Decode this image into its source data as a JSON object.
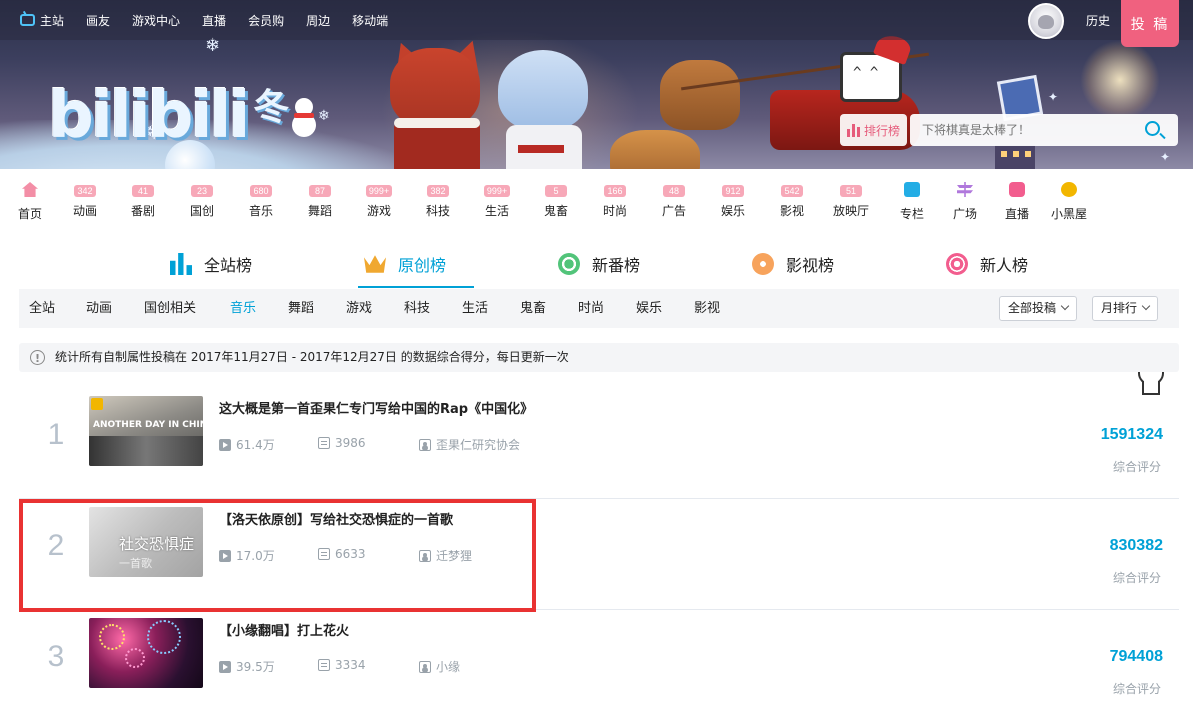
{
  "topnav": {
    "items": [
      "主站",
      "画友",
      "游戏中心",
      "直播",
      "会员购",
      "周边",
      "移动端"
    ],
    "history": "历史",
    "post": "投 稿"
  },
  "banner": {
    "logo_text": "bilibili",
    "logo_season": "冬",
    "rank_chip": "排行榜",
    "search_placeholder": "下将棋真是太棒了！"
  },
  "categories": [
    {
      "label": "首页",
      "badge": ""
    },
    {
      "label": "动画",
      "badge": "342"
    },
    {
      "label": "番剧",
      "badge": "41"
    },
    {
      "label": "国创",
      "badge": "23"
    },
    {
      "label": "音乐",
      "badge": "680"
    },
    {
      "label": "舞蹈",
      "badge": "87"
    },
    {
      "label": "游戏",
      "badge": "999+"
    },
    {
      "label": "科技",
      "badge": "382"
    },
    {
      "label": "生活",
      "badge": "999+"
    },
    {
      "label": "鬼畜",
      "badge": "5"
    },
    {
      "label": "时尚",
      "badge": "166"
    },
    {
      "label": "广告",
      "badge": "48"
    },
    {
      "label": "娱乐",
      "badge": "912"
    },
    {
      "label": "影视",
      "badge": "542"
    },
    {
      "label": "放映厅",
      "badge": "51"
    },
    {
      "label": "专栏",
      "badge": ""
    },
    {
      "label": "广场",
      "badge": ""
    },
    {
      "label": "直播",
      "badge": ""
    },
    {
      "label": "小黑屋",
      "badge": ""
    }
  ],
  "rank_tabs": [
    {
      "label": "全站榜",
      "icon": "bar-chart-icon",
      "color": "#00a1d6"
    },
    {
      "label": "原创榜",
      "icon": "crown-icon",
      "color": "#f0a830",
      "active": true
    },
    {
      "label": "新番榜",
      "icon": "circle-icon",
      "color": "#52c47a"
    },
    {
      "label": "影视榜",
      "icon": "film-reel-icon",
      "color": "#f7a35c"
    },
    {
      "label": "新人榜",
      "icon": "new-face-icon",
      "color": "#f25d8e"
    }
  ],
  "sub_tabs": [
    "全站",
    "动画",
    "国创相关",
    "音乐",
    "舞蹈",
    "游戏",
    "科技",
    "生活",
    "鬼畜",
    "时尚",
    "娱乐",
    "影视"
  ],
  "sub_active": "音乐",
  "dropdowns": {
    "type": "全部投稿",
    "period": "月排行"
  },
  "notice": "统计所有自制属性投稿在 2017年11月27日 - 2017年12月27日 的数据综合得分，每日更新一次",
  "rank_list": [
    {
      "rank": "1",
      "title": "这大概是第一首歪果仁专门写给中国的Rap《中国化》",
      "plays": "61.4万",
      "danmaku": "3986",
      "up": "歪果仁研究协会",
      "score": "1591324",
      "score_label": "综合评分",
      "thumb_text": "ANOTHER DAY IN CHINA"
    },
    {
      "rank": "2",
      "title": "【洛天依原创】写给社交恐惧症的一首歌",
      "plays": "17.0万",
      "danmaku": "6633",
      "up": "迁梦狸",
      "score": "830382",
      "score_label": "综合评分",
      "thumb_text": "社交恐惧症",
      "thumb_text2": "一首歌"
    },
    {
      "rank": "3",
      "title": "【小缘翻唱】打上花火",
      "plays": "39.5万",
      "danmaku": "3334",
      "up": "小缘",
      "score": "794408",
      "score_label": "综合评分"
    }
  ],
  "colors": {
    "accent": "#00a1d6",
    "pink": "#f0617f",
    "highlight": "#e93232"
  }
}
